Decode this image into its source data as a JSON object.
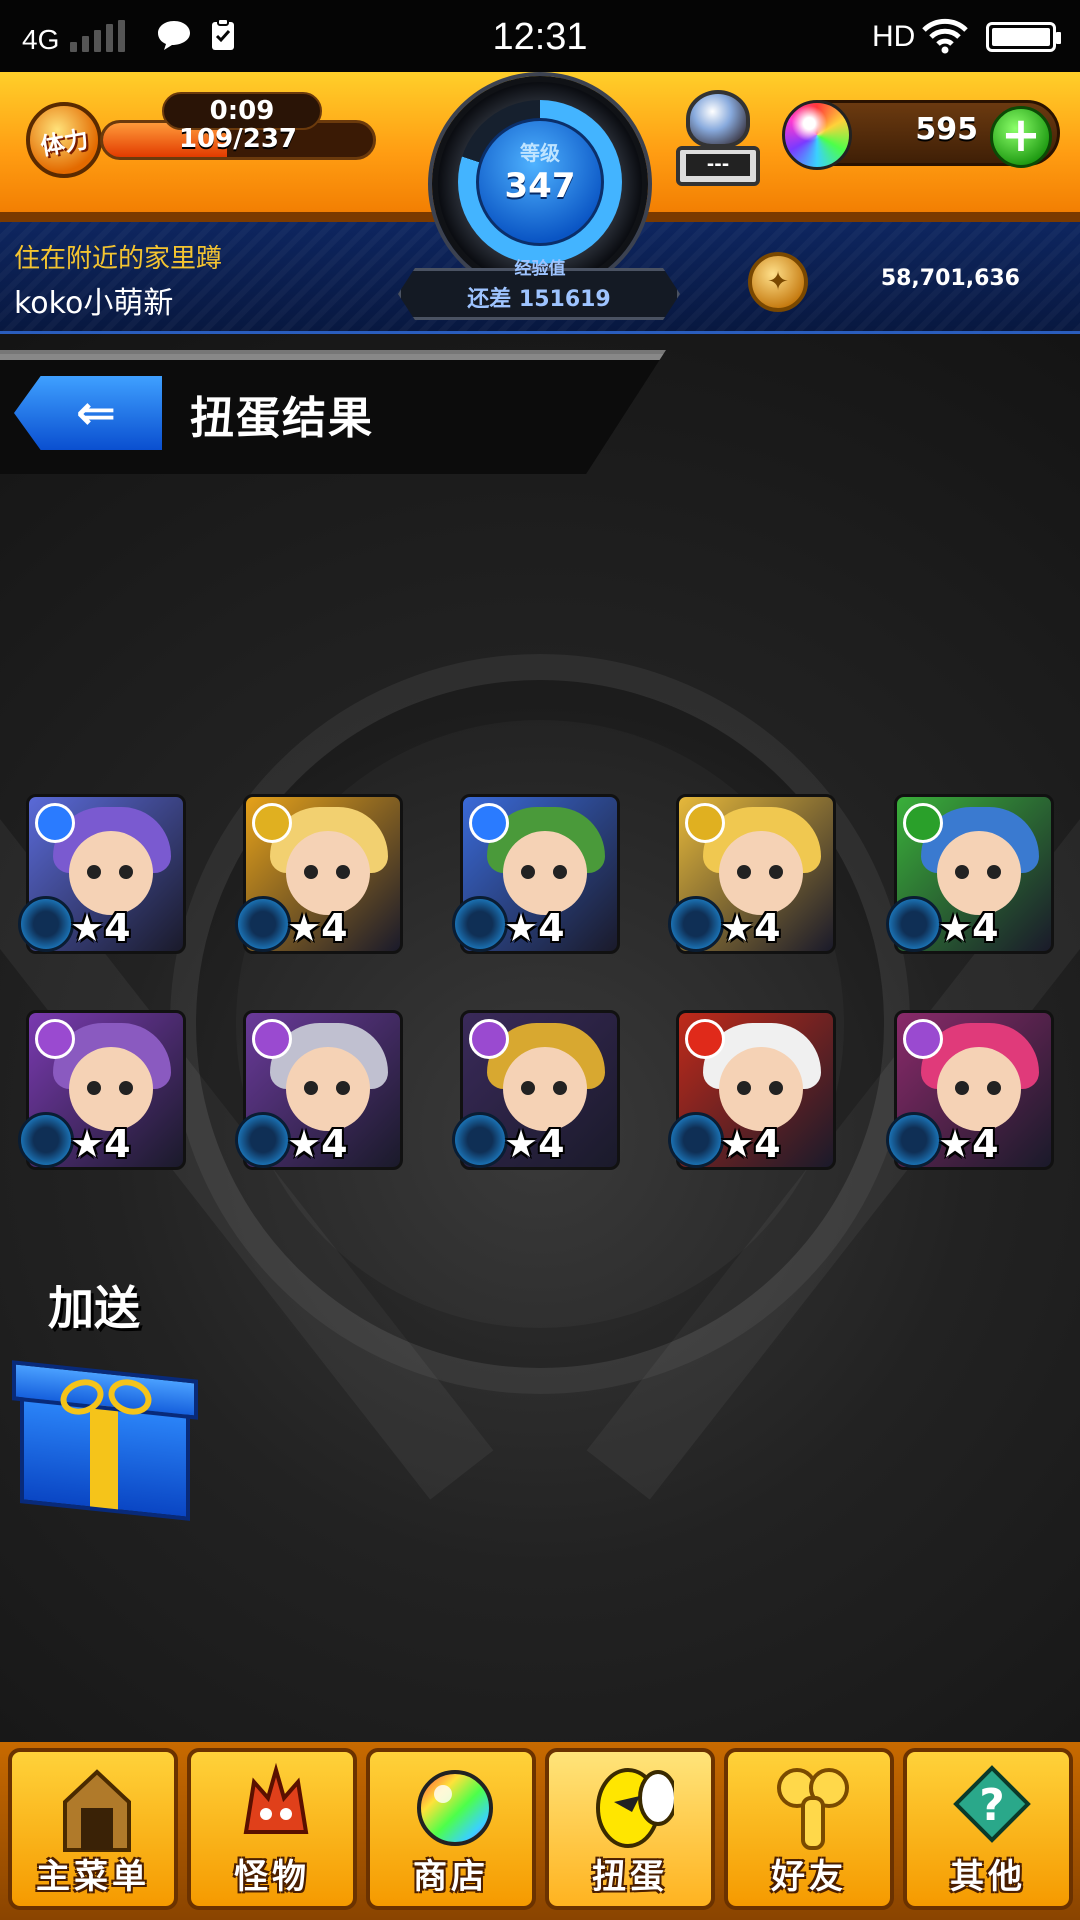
{
  "status_bar": {
    "network": "4G",
    "time": "12:31",
    "hd_label": "HD",
    "battery_level": 1.0,
    "icons": [
      "signal-icon",
      "chat-icon",
      "clipboard-icon",
      "wifi-icon",
      "battery-icon"
    ]
  },
  "header": {
    "stamina": {
      "badge": "体力",
      "timer": "0:09",
      "text": "109/237",
      "current": 109,
      "max": 237
    },
    "level": {
      "label": "等级",
      "value": "347",
      "progress": 0.8
    },
    "exp": {
      "label": "经验值",
      "value": "还差 151619"
    },
    "orb_machine": {
      "display": "---"
    },
    "orbs": {
      "count": "595",
      "add_symbol": "+"
    },
    "player": {
      "title": "住在附近的家里蹲",
      "name": "koko小萌新"
    },
    "gold": {
      "value": "58,701,636"
    }
  },
  "page": {
    "title": "扭蛋结果",
    "back_symbol": "⇐",
    "bonus_label": "加送"
  },
  "results": [
    {
      "rarity": "★4",
      "element": "water",
      "element_color": "#2a7bff",
      "frame_color": "#5a6ad8",
      "hair_color": "#7a5ad0"
    },
    {
      "rarity": "★4",
      "element": "light",
      "element_color": "#e0b020",
      "frame_color": "#e6a21a",
      "hair_color": "#f2d070"
    },
    {
      "rarity": "★4",
      "element": "water",
      "element_color": "#2a7bff",
      "frame_color": "#3a6ad8",
      "hair_color": "#4a9a3a"
    },
    {
      "rarity": "★4",
      "element": "light",
      "element_color": "#e0b020",
      "frame_color": "#e6b83a",
      "hair_color": "#f0c850"
    },
    {
      "rarity": "★4",
      "element": "wood",
      "element_color": "#2aa02a",
      "frame_color": "#3ab03a",
      "hair_color": "#3a7ad0"
    },
    {
      "rarity": "★4",
      "element": "dark",
      "element_color": "#9a4ad0",
      "frame_color": "#7a3ab0",
      "hair_color": "#8a5ac0"
    },
    {
      "rarity": "★4",
      "element": "dark",
      "element_color": "#9a4ad0",
      "frame_color": "#6a3a9a",
      "hair_color": "#c0c0d0"
    },
    {
      "rarity": "★4",
      "element": "dark",
      "element_color": "#9a4ad0",
      "frame_color": "#3a2a5a",
      "hair_color": "#d8a830"
    },
    {
      "rarity": "★4",
      "element": "fire",
      "element_color": "#e02a1a",
      "frame_color": "#c02a1a",
      "hair_color": "#f0f0f0"
    },
    {
      "rarity": "★4",
      "element": "dark",
      "element_color": "#9a4ad0",
      "frame_color": "#8a2a6a",
      "hair_color": "#e03a7a"
    }
  ],
  "nav": {
    "items": [
      {
        "label": "主菜单",
        "icon": "home-gate-icon",
        "active": false
      },
      {
        "label": "怪物",
        "icon": "monster-icon",
        "active": false
      },
      {
        "label": "商店",
        "icon": "orb-shop-icon",
        "active": false
      },
      {
        "label": "扭蛋",
        "icon": "gacha-egg-icon",
        "active": true
      },
      {
        "label": "好友",
        "icon": "friends-icon",
        "active": false
      },
      {
        "label": "其他",
        "icon": "question-icon",
        "active": false
      }
    ]
  }
}
